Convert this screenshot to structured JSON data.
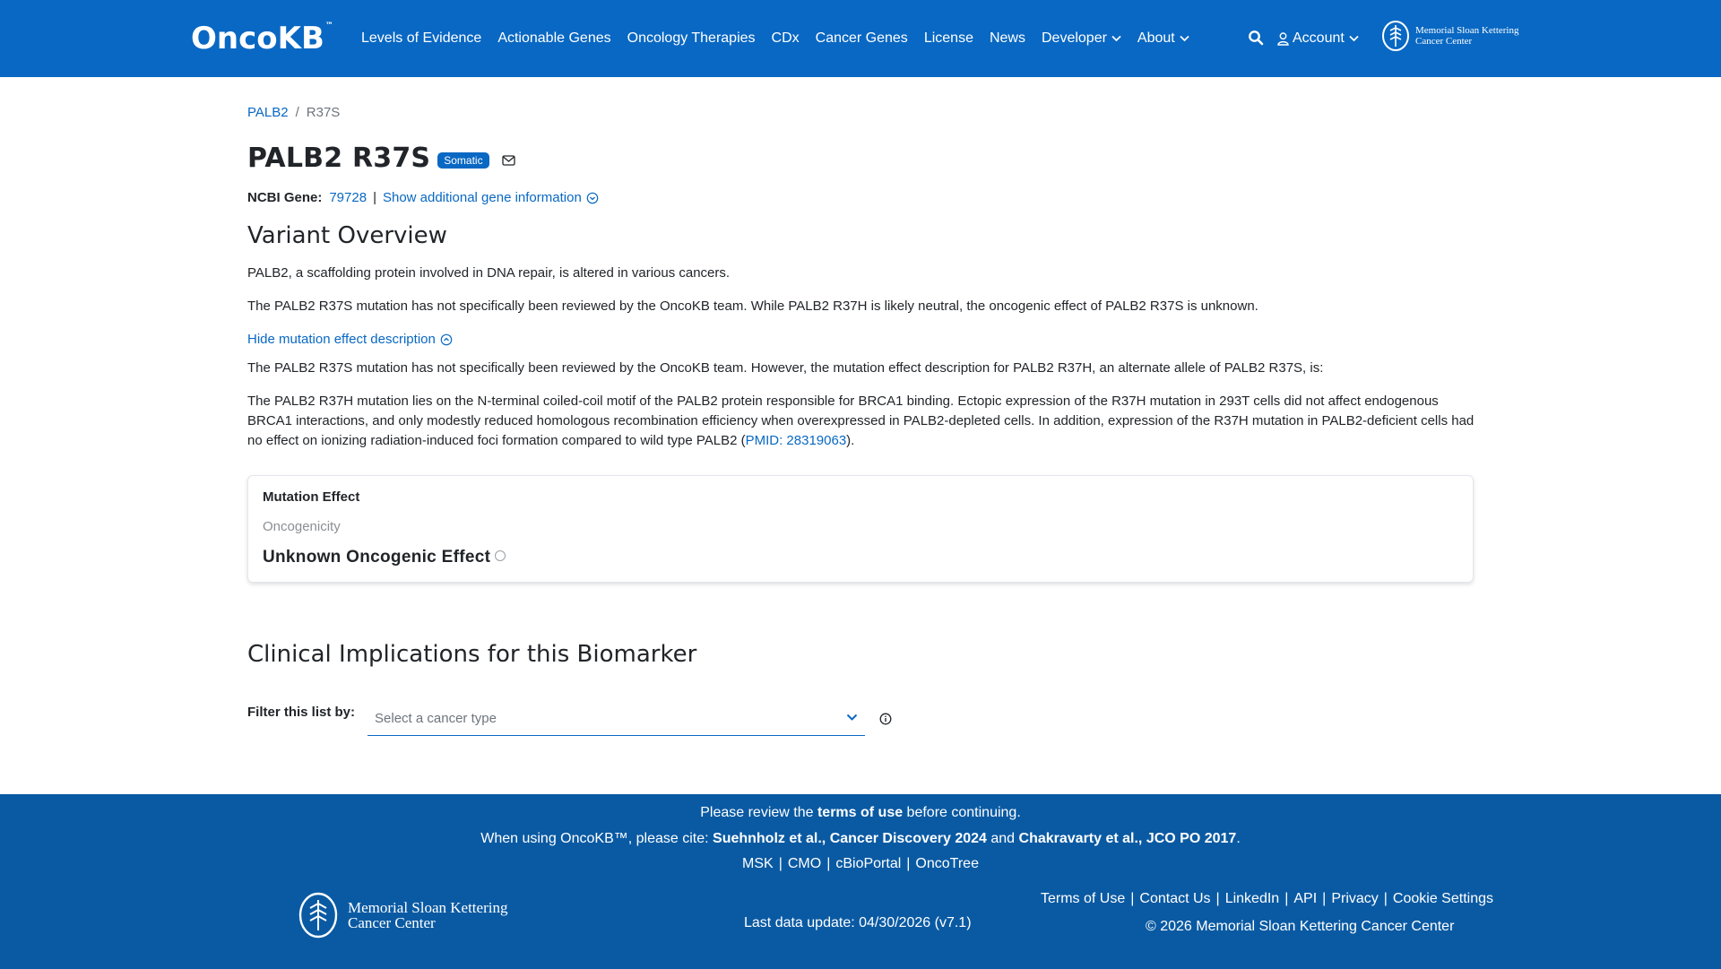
{
  "header": {
    "logo_text": "OncoKB",
    "logo_tm": "™",
    "nav": [
      {
        "label": "Levels of Evidence"
      },
      {
        "label": "Actionable Genes"
      },
      {
        "label": "Oncology Therapies"
      },
      {
        "label": "CDx"
      },
      {
        "label": "Cancer Genes"
      },
      {
        "label": "License"
      },
      {
        "label": "News"
      },
      {
        "label": "Developer"
      },
      {
        "label": "About"
      }
    ],
    "account_label": "Account",
    "msk_line1": "Memorial Sloan Kettering",
    "msk_line2": "Cancer Center"
  },
  "breadcrumb": {
    "gene": "PALB2",
    "separator": "/",
    "variant": "R37S"
  },
  "title": "PALB2 R37S",
  "badge": "Somatic",
  "gene_info": {
    "label": "NCBI Gene:",
    "ncbi_id": "79728",
    "pipe": "|",
    "toggle": "Show additional gene information"
  },
  "variant_overview": {
    "heading": "Variant Overview",
    "p1": "PALB2, a scaffolding protein involved in DNA repair, is altered in various cancers.",
    "p2": "The PALB2 R37S mutation has not specifically been reviewed by the OncoKB team. While PALB2 R37H is likely neutral, the oncogenic effect of PALB2 R37S is unknown.",
    "hide_link": "Hide mutation effect description",
    "p3": "The PALB2 R37S mutation has not specifically been reviewed by the OncoKB team. However, the mutation effect description for PALB2 R37H, an alternate allele of PALB2 R37S, is:",
    "p4_text": "The PALB2 R37H mutation lies on the N-terminal coiled-coil motif of the PALB2 protein responsible for BRCA1 binding. Ectopic expression of the R37H mutation in 293T cells did not affect endogenous BRCA1 interactions, and only modestly reduced homologous recombination efficiency when overexpressed in PALB2-depleted cells. In addition, expression of the R37H mutation in PALB2-deficient cells had no effect on ionizing radiation-induced foci formation compared to wild type PALB2 (",
    "p4_pmid": "PMID: 28319063",
    "p4_end": ")."
  },
  "mutation_effect": {
    "title": "Mutation Effect",
    "subtitle": "Oncogenicity",
    "value": "Unknown Oncogenic Effect"
  },
  "clinical": {
    "heading": "Clinical Implications for this Biomarker",
    "filter_label": "Filter this list by:",
    "select_placeholder": "Select a cancer type"
  },
  "footer": {
    "review_pre": "Please review the ",
    "review_link": "terms of use",
    "review_post": " before continuing.",
    "cite_pre": "When using OncoKB™, please cite: ",
    "cite_1": "Suehnholz et al., Cancer Discovery 2024",
    "cite_and": " and ",
    "cite_2": "Chakravarty et al., JCO PO 2017",
    "cite_end": ".",
    "links": [
      "MSK",
      "CMO",
      "cBioPortal",
      "OncoTree"
    ],
    "msk_line1": "Memorial Sloan Kettering",
    "msk_line2": "Cancer Center",
    "last_update": "Last data update: 04/30/2026 (v7.1)",
    "right_links": [
      "Terms of Use",
      "Contact Us",
      "LinkedIn",
      "API",
      "Privacy",
      "Cookie Settings"
    ],
    "copyright": "© 2026 Memorial Sloan Kettering Cancer Center"
  },
  "colors": {
    "primary": "#0968c3",
    "footer": "#0a5aa3"
  },
  "icons": [
    "search-icon",
    "user-icon",
    "chevron-down-icon",
    "mail-icon",
    "circle-chevron-icon",
    "info-icon",
    "msk-logo-icon"
  ]
}
